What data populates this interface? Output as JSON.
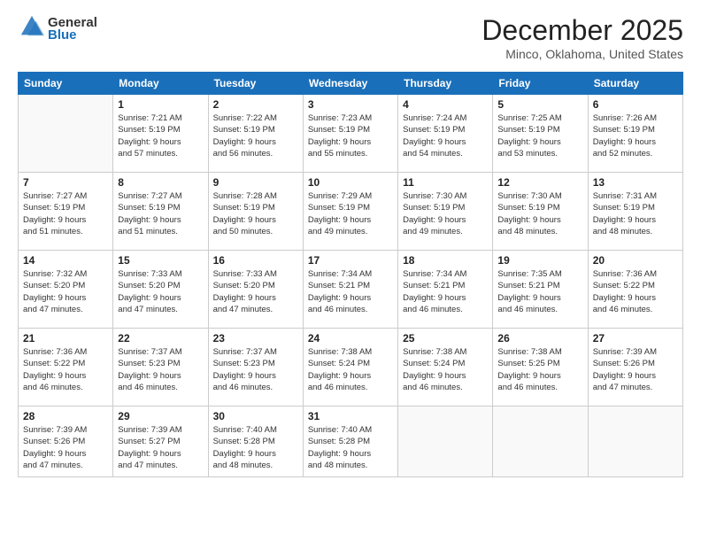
{
  "logo": {
    "general": "General",
    "blue": "Blue"
  },
  "header": {
    "month": "December 2025",
    "location": "Minco, Oklahoma, United States"
  },
  "weekdays": [
    "Sunday",
    "Monday",
    "Tuesday",
    "Wednesday",
    "Thursday",
    "Friday",
    "Saturday"
  ],
  "weeks": [
    [
      {
        "day": "",
        "info": ""
      },
      {
        "day": "1",
        "info": "Sunrise: 7:21 AM\nSunset: 5:19 PM\nDaylight: 9 hours\nand 57 minutes."
      },
      {
        "day": "2",
        "info": "Sunrise: 7:22 AM\nSunset: 5:19 PM\nDaylight: 9 hours\nand 56 minutes."
      },
      {
        "day": "3",
        "info": "Sunrise: 7:23 AM\nSunset: 5:19 PM\nDaylight: 9 hours\nand 55 minutes."
      },
      {
        "day": "4",
        "info": "Sunrise: 7:24 AM\nSunset: 5:19 PM\nDaylight: 9 hours\nand 54 minutes."
      },
      {
        "day": "5",
        "info": "Sunrise: 7:25 AM\nSunset: 5:19 PM\nDaylight: 9 hours\nand 53 minutes."
      },
      {
        "day": "6",
        "info": "Sunrise: 7:26 AM\nSunset: 5:19 PM\nDaylight: 9 hours\nand 52 minutes."
      }
    ],
    [
      {
        "day": "7",
        "info": "Sunrise: 7:27 AM\nSunset: 5:19 PM\nDaylight: 9 hours\nand 51 minutes."
      },
      {
        "day": "8",
        "info": "Sunrise: 7:27 AM\nSunset: 5:19 PM\nDaylight: 9 hours\nand 51 minutes."
      },
      {
        "day": "9",
        "info": "Sunrise: 7:28 AM\nSunset: 5:19 PM\nDaylight: 9 hours\nand 50 minutes."
      },
      {
        "day": "10",
        "info": "Sunrise: 7:29 AM\nSunset: 5:19 PM\nDaylight: 9 hours\nand 49 minutes."
      },
      {
        "day": "11",
        "info": "Sunrise: 7:30 AM\nSunset: 5:19 PM\nDaylight: 9 hours\nand 49 minutes."
      },
      {
        "day": "12",
        "info": "Sunrise: 7:30 AM\nSunset: 5:19 PM\nDaylight: 9 hours\nand 48 minutes."
      },
      {
        "day": "13",
        "info": "Sunrise: 7:31 AM\nSunset: 5:19 PM\nDaylight: 9 hours\nand 48 minutes."
      }
    ],
    [
      {
        "day": "14",
        "info": "Sunrise: 7:32 AM\nSunset: 5:20 PM\nDaylight: 9 hours\nand 47 minutes."
      },
      {
        "day": "15",
        "info": "Sunrise: 7:33 AM\nSunset: 5:20 PM\nDaylight: 9 hours\nand 47 minutes."
      },
      {
        "day": "16",
        "info": "Sunrise: 7:33 AM\nSunset: 5:20 PM\nDaylight: 9 hours\nand 47 minutes."
      },
      {
        "day": "17",
        "info": "Sunrise: 7:34 AM\nSunset: 5:21 PM\nDaylight: 9 hours\nand 46 minutes."
      },
      {
        "day": "18",
        "info": "Sunrise: 7:34 AM\nSunset: 5:21 PM\nDaylight: 9 hours\nand 46 minutes."
      },
      {
        "day": "19",
        "info": "Sunrise: 7:35 AM\nSunset: 5:21 PM\nDaylight: 9 hours\nand 46 minutes."
      },
      {
        "day": "20",
        "info": "Sunrise: 7:36 AM\nSunset: 5:22 PM\nDaylight: 9 hours\nand 46 minutes."
      }
    ],
    [
      {
        "day": "21",
        "info": "Sunrise: 7:36 AM\nSunset: 5:22 PM\nDaylight: 9 hours\nand 46 minutes."
      },
      {
        "day": "22",
        "info": "Sunrise: 7:37 AM\nSunset: 5:23 PM\nDaylight: 9 hours\nand 46 minutes."
      },
      {
        "day": "23",
        "info": "Sunrise: 7:37 AM\nSunset: 5:23 PM\nDaylight: 9 hours\nand 46 minutes."
      },
      {
        "day": "24",
        "info": "Sunrise: 7:38 AM\nSunset: 5:24 PM\nDaylight: 9 hours\nand 46 minutes."
      },
      {
        "day": "25",
        "info": "Sunrise: 7:38 AM\nSunset: 5:24 PM\nDaylight: 9 hours\nand 46 minutes."
      },
      {
        "day": "26",
        "info": "Sunrise: 7:38 AM\nSunset: 5:25 PM\nDaylight: 9 hours\nand 46 minutes."
      },
      {
        "day": "27",
        "info": "Sunrise: 7:39 AM\nSunset: 5:26 PM\nDaylight: 9 hours\nand 47 minutes."
      }
    ],
    [
      {
        "day": "28",
        "info": "Sunrise: 7:39 AM\nSunset: 5:26 PM\nDaylight: 9 hours\nand 47 minutes."
      },
      {
        "day": "29",
        "info": "Sunrise: 7:39 AM\nSunset: 5:27 PM\nDaylight: 9 hours\nand 47 minutes."
      },
      {
        "day": "30",
        "info": "Sunrise: 7:40 AM\nSunset: 5:28 PM\nDaylight: 9 hours\nand 48 minutes."
      },
      {
        "day": "31",
        "info": "Sunrise: 7:40 AM\nSunset: 5:28 PM\nDaylight: 9 hours\nand 48 minutes."
      },
      {
        "day": "",
        "info": ""
      },
      {
        "day": "",
        "info": ""
      },
      {
        "day": "",
        "info": ""
      }
    ]
  ]
}
